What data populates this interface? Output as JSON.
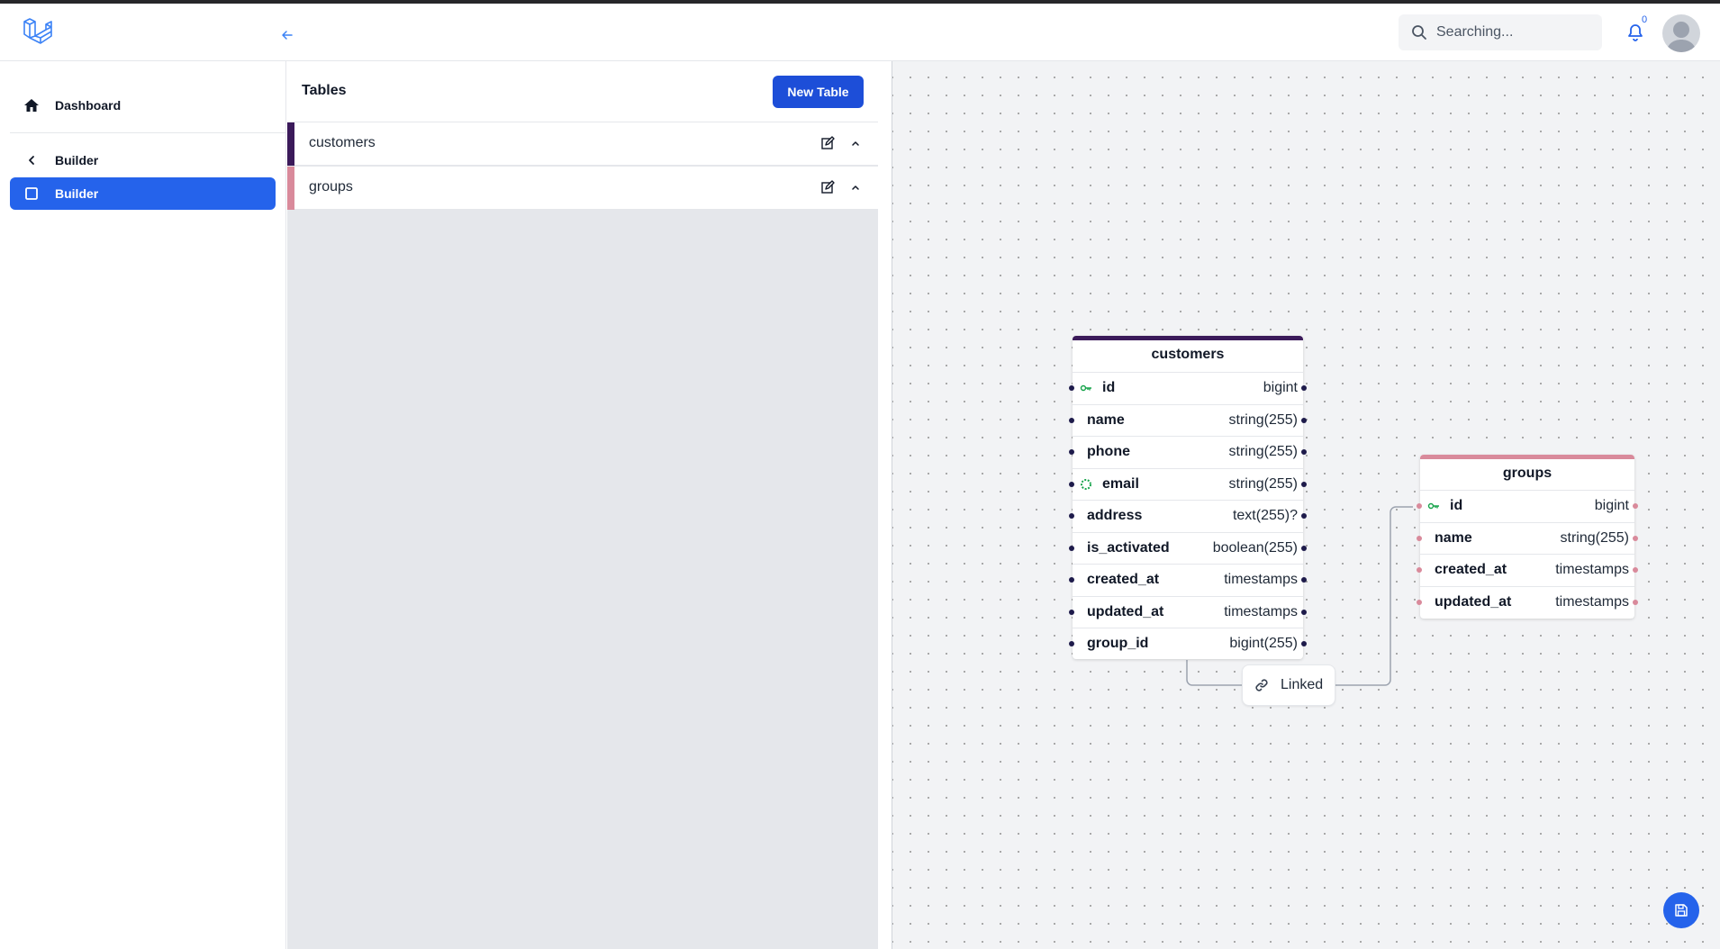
{
  "header": {
    "search_placeholder": "Searching...",
    "notification_count": "0"
  },
  "sidebar": {
    "items": [
      {
        "label": "Dashboard",
        "icon": "home-icon"
      },
      {
        "label": "Builder",
        "icon": "chevron-left-icon"
      },
      {
        "label": "Builder",
        "icon": "square-icon",
        "active": true
      }
    ]
  },
  "tables_panel": {
    "title": "Tables",
    "new_button": "New Table",
    "tables": [
      {
        "name": "customers",
        "color": "#3b1a5a"
      },
      {
        "name": "groups",
        "color": "#d98a9b"
      }
    ]
  },
  "diagram": {
    "customers": {
      "title": "customers",
      "color": "#3b1a5a",
      "columns": [
        {
          "name": "id",
          "type": "bigint",
          "icon": "key-icon"
        },
        {
          "name": "name",
          "type": "string(255)"
        },
        {
          "name": "phone",
          "type": "string(255)"
        },
        {
          "name": "email",
          "type": "string(255)",
          "icon": "unique-icon"
        },
        {
          "name": "address",
          "type": "text(255)?"
        },
        {
          "name": "is_activated",
          "type": "boolean(255)"
        },
        {
          "name": "created_at",
          "type": "timestamps"
        },
        {
          "name": "updated_at",
          "type": "timestamps"
        },
        {
          "name": "group_id",
          "type": "bigint(255)"
        }
      ]
    },
    "groups": {
      "title": "groups",
      "color": "#d98a9b",
      "columns": [
        {
          "name": "id",
          "type": "bigint",
          "icon": "key-icon"
        },
        {
          "name": "name",
          "type": "string(255)"
        },
        {
          "name": "created_at",
          "type": "timestamps"
        },
        {
          "name": "updated_at",
          "type": "timestamps"
        }
      ]
    },
    "relation_label": "Linked"
  },
  "colors": {
    "accent": "#2563eb",
    "key_icon": "#16a34a"
  }
}
